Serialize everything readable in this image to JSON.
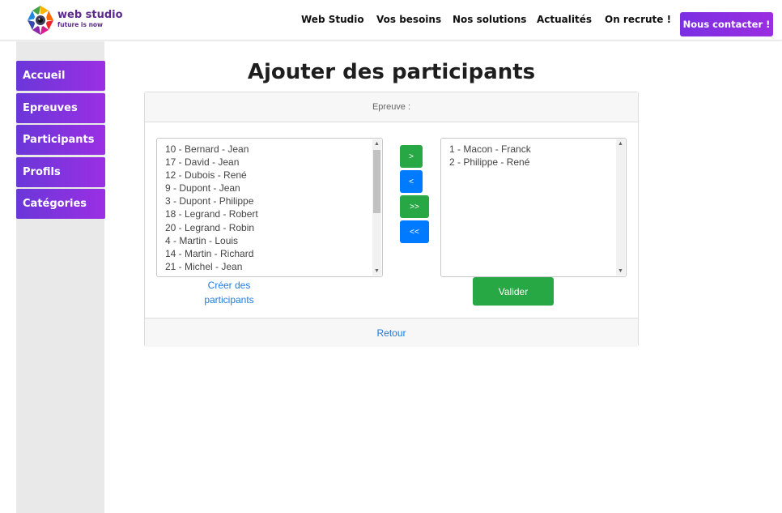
{
  "header": {
    "brand_name": "web studio",
    "brand_tagline": "future is now",
    "nav": [
      "Web Studio",
      "Vos besoins",
      "Nos solutions",
      "Actualités",
      "On recrute !"
    ],
    "contact_label": "Nous contacter !"
  },
  "sidebar": {
    "items": [
      {
        "label": "Accueil"
      },
      {
        "label": "Epreuves"
      },
      {
        "label": "Participants"
      },
      {
        "label": "Profils"
      },
      {
        "label": "Catégories"
      }
    ]
  },
  "main": {
    "title": "Ajouter des participants",
    "epreuve_label": "Epreuve :",
    "available": [
      "10 - Bernard - Jean",
      "17 - David - Jean",
      "12 - Dubois - René",
      "9 - Dupont - Jean",
      "3 - Dupont - Philippe",
      "18 - Legrand - Robert",
      "20 - Legrand - Robin",
      "4 - Martin - Louis",
      "14 - Martin - Richard",
      "21 - Michel - Jean"
    ],
    "selected": [
      "1 - Macon - Franck",
      "2 - Philippe - René"
    ],
    "buttons": {
      "add": ">",
      "remove": "<",
      "add_all": ">>",
      "remove_all": "<<"
    },
    "create_link": "Créer des participants",
    "validate_label": "Valider",
    "back_label": "Retour"
  },
  "colors": {
    "brand_purple": "#7b2fe3",
    "success_green": "#28a745",
    "primary_blue": "#007bff",
    "link_blue": "#1f7ae0"
  }
}
